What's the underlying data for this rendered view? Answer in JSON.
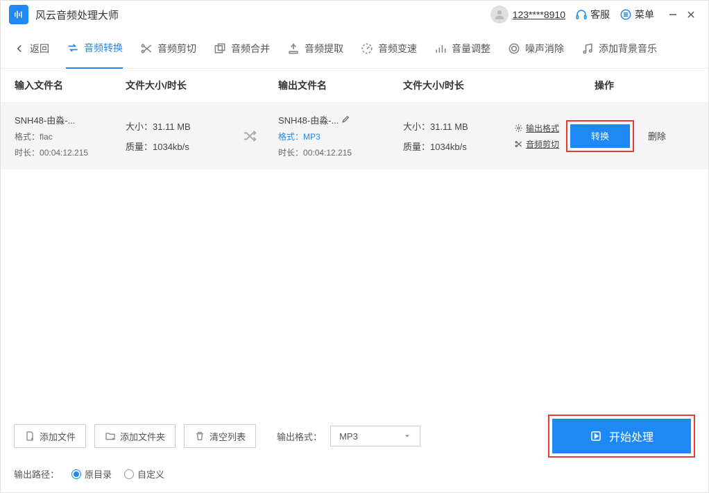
{
  "titlebar": {
    "app_name": "风云音频处理大师",
    "user_id": "123****8910",
    "support": "客服",
    "menu": "菜单"
  },
  "toolbar": {
    "back": "返回",
    "items": [
      "音频转换",
      "音频剪切",
      "音频合并",
      "音频提取",
      "音频变速",
      "音量调整",
      "噪声消除",
      "添加背景音乐"
    ]
  },
  "table": {
    "headers": {
      "input": "输入文件名",
      "size_dur": "文件大小/时长",
      "output": "输出文件名",
      "size_dur2": "文件大小/时长",
      "op": "操作"
    },
    "row": {
      "in_name": "SNH48-由淼-...",
      "in_format_label": "格式：",
      "in_format": "flac",
      "in_dur_label": "时长：",
      "in_dur": "00:04:12.215",
      "size_label": "大小：",
      "size": "31.11 MB",
      "quality_label": "质量：",
      "quality": "1034kb/s",
      "out_name": "SNH48-由淼-...",
      "out_format_label": "格式：",
      "out_format": "MP3",
      "out_dur_label": "时长：",
      "out_dur": "00:04:12.215",
      "size2": "31.11 MB",
      "quality2": "1034kb/s",
      "op_format": "输出格式",
      "op_cut": "音频剪切",
      "convert": "转换",
      "delete": "删除"
    }
  },
  "bottom": {
    "add_file": "添加文件",
    "add_folder": "添加文件夹",
    "clear": "清空列表",
    "out_fmt_label": "输出格式：",
    "out_fmt": "MP3",
    "start": "开始处理",
    "out_path_label": "输出路径：",
    "radio_orig": "原目录",
    "radio_custom": "自定义"
  }
}
